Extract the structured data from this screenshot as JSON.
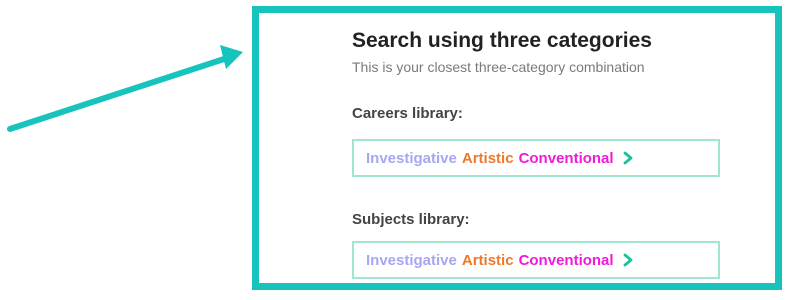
{
  "panel": {
    "title": "Search using three categories",
    "subtitle": "This is your closest three-category combination"
  },
  "careers": {
    "label": "Careers library:",
    "categories": {
      "first": "Investigative",
      "second": "Artistic",
      "third": "Conventional"
    }
  },
  "subjects": {
    "label": "Subjects library:",
    "categories": {
      "first": "Investigative",
      "second": "Artistic",
      "third": "Conventional"
    }
  },
  "colors": {
    "accent_teal": "#17c4bd",
    "investigative": "#a6a6f2",
    "artistic": "#ed7a2c",
    "conventional": "#ee1bd8",
    "chevron": "#19c29a",
    "link_border": "#9fe6cf"
  },
  "icons": {
    "pointer": "arrow-pointer-icon",
    "link_chevron": "chevron-right-icon"
  }
}
